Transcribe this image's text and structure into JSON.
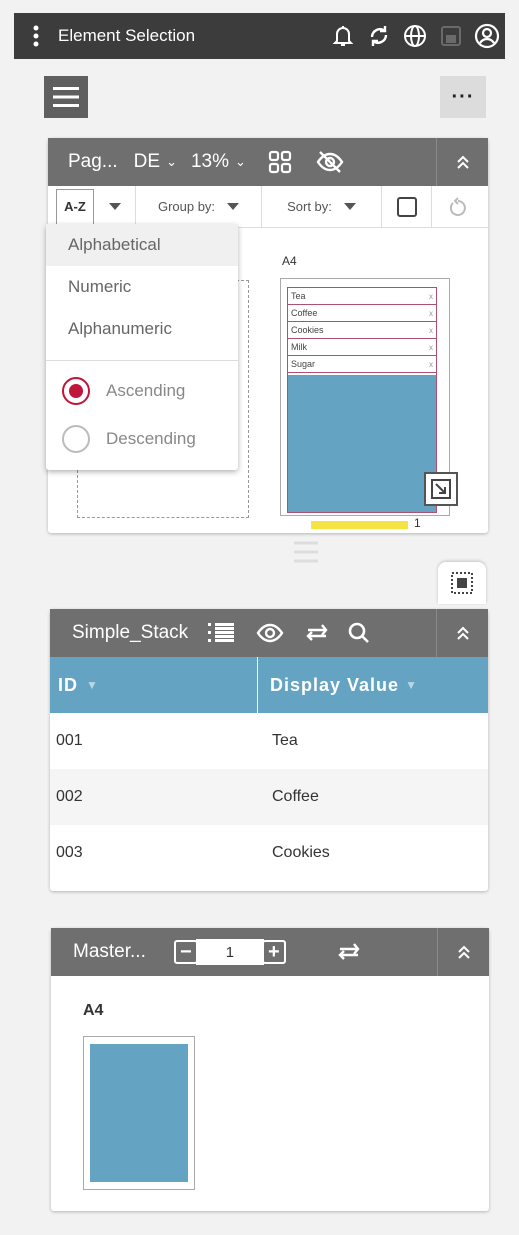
{
  "topbar": {
    "title": "Element Selection",
    "icons": [
      "kebab-menu-icon",
      "bell-icon",
      "sync-icon",
      "globe-icon",
      "save-icon",
      "account-icon"
    ]
  },
  "toolbar": {
    "more_label": "···"
  },
  "pages_panel": {
    "title": "Pag...",
    "language": "DE",
    "zoom": "13%",
    "sort_button": "A-Z",
    "group_by": "Group by:",
    "sort_by": "Sort by:",
    "page_label": "A4",
    "page_number": "1",
    "dropdown": {
      "items": [
        "Alphabetical",
        "Numeric",
        "Alphanumeric"
      ],
      "selected": "Alphabetical",
      "ascending": "Ascending",
      "descending": "Descending",
      "order": "Ascending"
    },
    "slots": [
      "Tea",
      "Coffee",
      "Cookies",
      "Milk",
      "Sugar"
    ],
    "fill_color": "#64a3c2"
  },
  "stack_panel": {
    "title": "Simple_Stack",
    "columns": [
      "ID",
      "Display Value"
    ],
    "rows": [
      {
        "id": "001",
        "value": "Tea"
      },
      {
        "id": "002",
        "value": "Coffee"
      },
      {
        "id": "003",
        "value": "Cookies"
      }
    ]
  },
  "master_panel": {
    "title": "Master...",
    "stepper_value": "1",
    "page_label": "A4"
  },
  "colors": {
    "header": "#6f6f6f",
    "topbar": "#3c3c3c",
    "accent": "#64a3c2",
    "brand": "#c0163b"
  }
}
